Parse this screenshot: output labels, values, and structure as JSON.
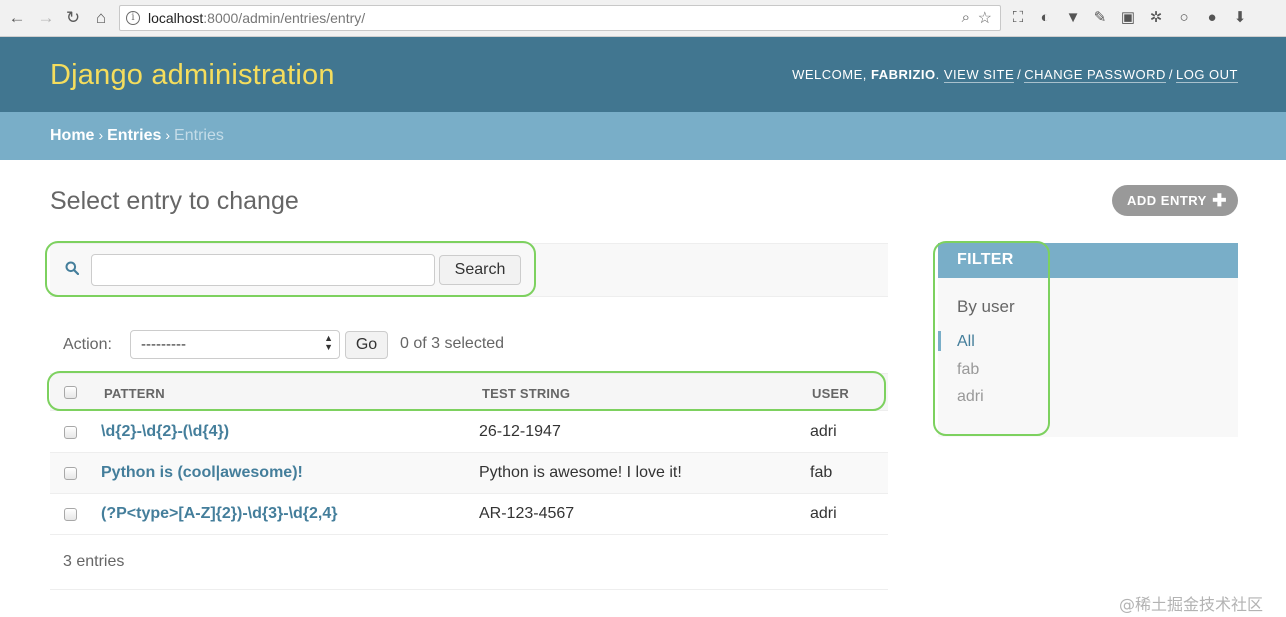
{
  "browser": {
    "url_host": "localhost",
    "url_path": ":8000/admin/entries/entry/"
  },
  "header": {
    "branding": "Django administration",
    "welcome": "WELCOME,",
    "username": "FABRIZIO",
    "view_site": "VIEW SITE",
    "change_password": "CHANGE PASSWORD",
    "log_out": "LOG OUT"
  },
  "breadcrumbs": {
    "home": "Home",
    "app": "Entries",
    "current": "Entries"
  },
  "main": {
    "title": "Select entry to change",
    "add_button": "ADD ENTRY"
  },
  "search": {
    "value": "",
    "button": "Search"
  },
  "actions": {
    "label": "Action:",
    "selected_option": "---------",
    "go": "Go",
    "counter": "0 of 3 selected"
  },
  "table": {
    "columns": [
      "PATTERN",
      "TEST STRING",
      "USER"
    ],
    "rows": [
      {
        "pattern": "\\d{2}-\\d{2}-(\\d{4})",
        "test_string": "26-12-1947",
        "user": "adri"
      },
      {
        "pattern": "Python is (cool|awesome)!",
        "test_string": "Python is awesome! I love it!",
        "user": "fab"
      },
      {
        "pattern": "(?P<type>[A-Z]{2})-\\d{3}-\\d{2,4}",
        "test_string": "AR-123-4567",
        "user": "adri"
      }
    ],
    "paginator": "3 entries"
  },
  "filter": {
    "heading": "FILTER",
    "subtitle": "By user",
    "options": [
      "All",
      "fab",
      "adri"
    ],
    "selected": "All"
  },
  "watermark": "@稀土掘金技术社区",
  "colors": {
    "header_bg": "#417690",
    "branding": "#f5dd5d",
    "breadcrumb_bg": "#79aec8",
    "link": "#447e9b",
    "highlight": "#7dd15f"
  }
}
